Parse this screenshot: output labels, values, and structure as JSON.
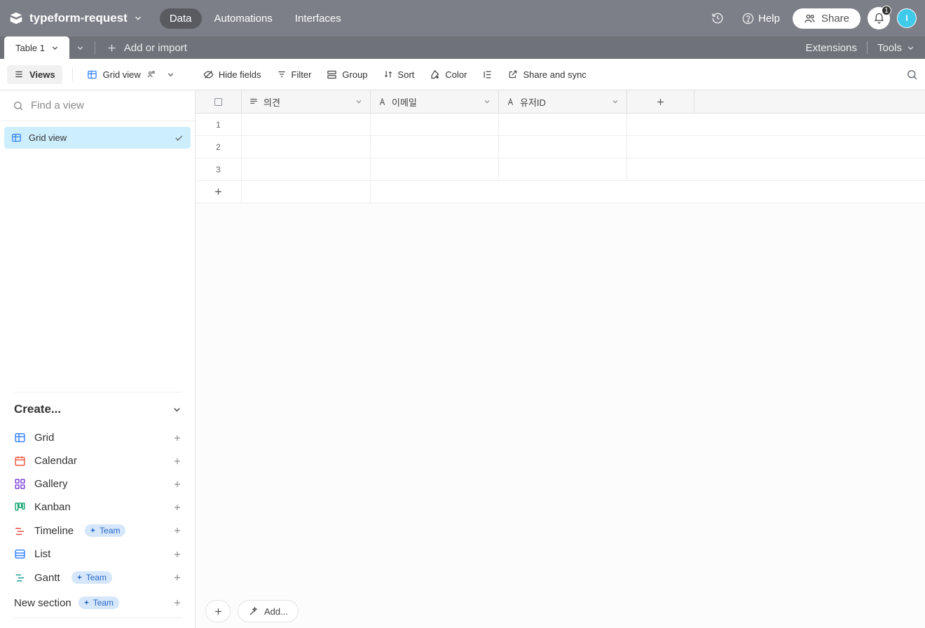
{
  "topbar": {
    "base_name": "typeform-request",
    "tabs": {
      "data": "Data",
      "automations": "Automations",
      "interfaces": "Interfaces"
    },
    "help": "Help",
    "share": "Share",
    "notification_count": "1",
    "avatar_initial": "I"
  },
  "secbar": {
    "table_tab": "Table 1",
    "add_or_import": "Add or import",
    "extensions": "Extensions",
    "tools": "Tools"
  },
  "viewbar": {
    "views": "Views",
    "grid_view": "Grid view",
    "hide_fields": "Hide fields",
    "filter": "Filter",
    "group": "Group",
    "sort": "Sort",
    "color": "Color",
    "share_sync": "Share and sync"
  },
  "sidebar": {
    "find_placeholder": "Find a view",
    "view_item": "Grid view",
    "create_label": "Create...",
    "items": {
      "grid": "Grid",
      "calendar": "Calendar",
      "gallery": "Gallery",
      "kanban": "Kanban",
      "timeline": "Timeline",
      "list": "List",
      "gantt": "Gantt"
    },
    "team_pill": "Team",
    "new_section": "New section"
  },
  "grid": {
    "columns": {
      "c1": "의견",
      "c2": "이메일",
      "c3": "유저ID"
    },
    "rows": [
      "1",
      "2",
      "3"
    ],
    "add_button": "Add..."
  }
}
